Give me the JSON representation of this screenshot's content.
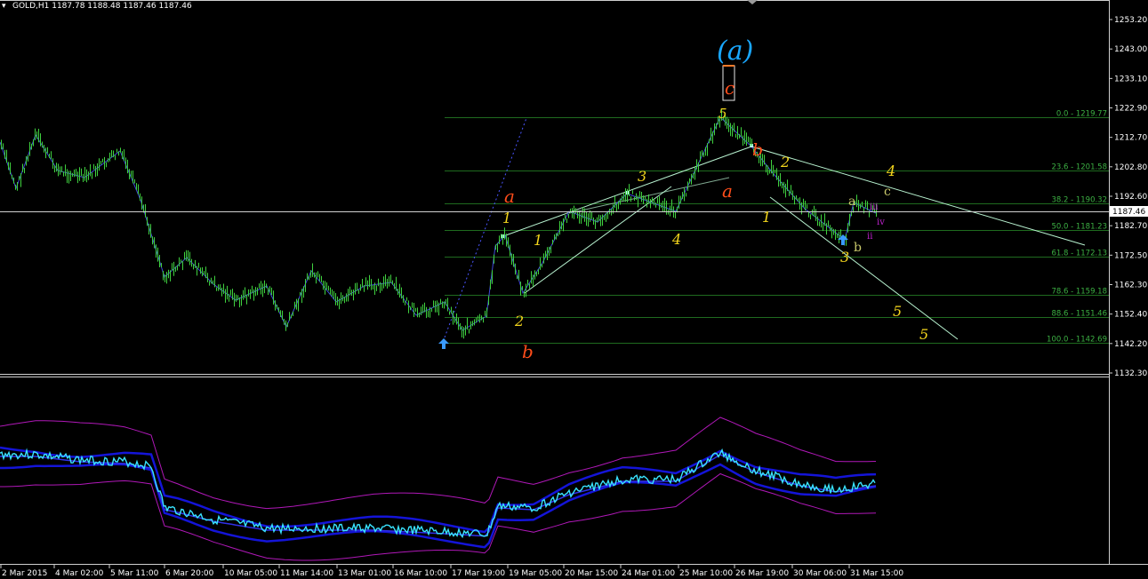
{
  "header": {
    "symbol_info": "GOLD,H1  1187.78 1188.48 1187.46 1187.46"
  },
  "current_price": "1187.46",
  "colors": {
    "background": "#000000",
    "bars": "#3fd13f",
    "fib_lines": "#1f6b1f",
    "fib_labels": "#3cb043",
    "trendlines": "#b7f1cf",
    "zigzag": "#3f49d8",
    "wave_yellow": "#f2d41c",
    "wave_red": "#ff4d1a",
    "wave_cyan": "#19a7ff",
    "wave_magenta": "#c023d0",
    "arrow": "#3a9bff",
    "osc_cyan": "#39e3ff",
    "osc_blue": "#1414d8",
    "osc_bands": "#b018b8"
  },
  "price_axis": {
    "labels": [
      "1253.20",
      "1243.00",
      "1233.10",
      "1222.90",
      "1212.70",
      "1202.80",
      "1192.60",
      "1182.70",
      "1172.50",
      "1162.30",
      "1152.40",
      "1142.20",
      "1132.30"
    ]
  },
  "time_axis": {
    "labels": [
      "2 Mar 2015",
      "4 Mar 02:00",
      "5 Mar 11:00",
      "6 Mar 20:00",
      "10 Mar 05:00",
      "11 Mar 14:00",
      "13 Mar 01:00",
      "16 Mar 10:00",
      "17 Mar 19:00",
      "19 Mar 05:00",
      "20 Mar 15:00",
      "24 Mar 01:00",
      "25 Mar 10:00",
      "26 Mar 19:00",
      "30 Mar 06:00",
      "31 Mar 15:00"
    ]
  },
  "fib_levels": [
    {
      "label": "0.0 - 1219.77",
      "price": 1219.77
    },
    {
      "label": "23.6 - 1201.58",
      "price": 1201.58
    },
    {
      "label": "38.2 - 1190.32",
      "price": 1190.32
    },
    {
      "label": "50.0 - 1181.23",
      "price": 1181.23
    },
    {
      "label": "61.8 - 1172.13",
      "price": 1172.13
    },
    {
      "label": "78.6 - 1159.18",
      "price": 1159.18
    },
    {
      "label": "88.6 - 1151.46",
      "price": 1151.46
    },
    {
      "label": "100.0 - 1142.69",
      "price": 1142.69
    }
  ],
  "wave_labels": {
    "a_big": "(a)",
    "c_big": "c",
    "five_top": "5",
    "b_top": "b",
    "a_red1": "a",
    "b_red1": "b",
    "a_red2": "a",
    "one_1": "1",
    "one_2": "1",
    "one_3": "1",
    "two_1": "2",
    "two_2": "2",
    "three_1": "3",
    "three_2": "3",
    "four_1": "4",
    "four_2": "4",
    "five_1": "5",
    "five_2": "5",
    "a_small": "a",
    "b_small": "b",
    "c_small": "c",
    "ii": "ii",
    "iii": "iii",
    "iv": "iv"
  },
  "chart_data": {
    "type": "line",
    "title": "GOLD,H1",
    "xlabel": "",
    "ylabel": "",
    "ylim": [
      1128.0,
      1258.0
    ],
    "x": [
      "2 Mar 2015",
      "4 Mar 02:00",
      "5 Mar 11:00",
      "6 Mar 20:00",
      "10 Mar 05:00",
      "11 Mar 14:00",
      "13 Mar 01:00",
      "16 Mar 10:00",
      "17 Mar 19:00",
      "19 Mar 05:00",
      "20 Mar 15:00",
      "24 Mar 01:00",
      "25 Mar 10:00",
      "26 Mar 19:00",
      "30 Mar 06:00",
      "31 Mar 15:00"
    ],
    "series": [
      {
        "values": [
          1208,
          1206,
          1204,
          1175,
          1166,
          1160,
          1161,
          1157,
          1152,
          1176,
          1187,
          1192,
          1204,
          1198,
          1180,
          1187
        ]
      }
    ],
    "grid": false
  }
}
